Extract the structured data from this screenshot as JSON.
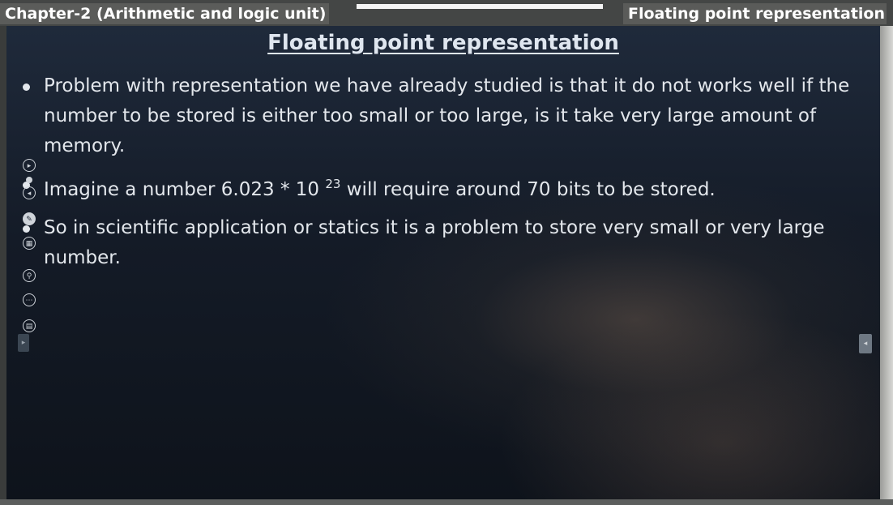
{
  "header": {
    "left_title": "Chapter-2 (Arithmetic and logic unit)",
    "right_title": "Floating point representation"
  },
  "slide": {
    "title": "Floating point representation",
    "bullets": [
      {
        "text": "Problem with representation we have already studied is that it do not works well if the number to be stored is either too small or too large, is it take very large amount of memory."
      },
      {
        "before": "Imagine a number 6.023 * 10 ",
        "superscript": "23",
        "after": " will require around 70 bits to be stored."
      },
      {
        "text": "So in scientific application or statics it is a problem to store very small or very large number."
      }
    ]
  },
  "toolbar": {
    "icons": [
      "play-next-icon",
      "dot-icon",
      "play-prev-icon",
      "pen-icon",
      "gallery-icon",
      "zoom-icon",
      "more-icon",
      "subtitle-icon"
    ]
  },
  "colors": {
    "slide_background": "#141b27",
    "text": "#e3e7ec",
    "header_band": "#444645"
  }
}
